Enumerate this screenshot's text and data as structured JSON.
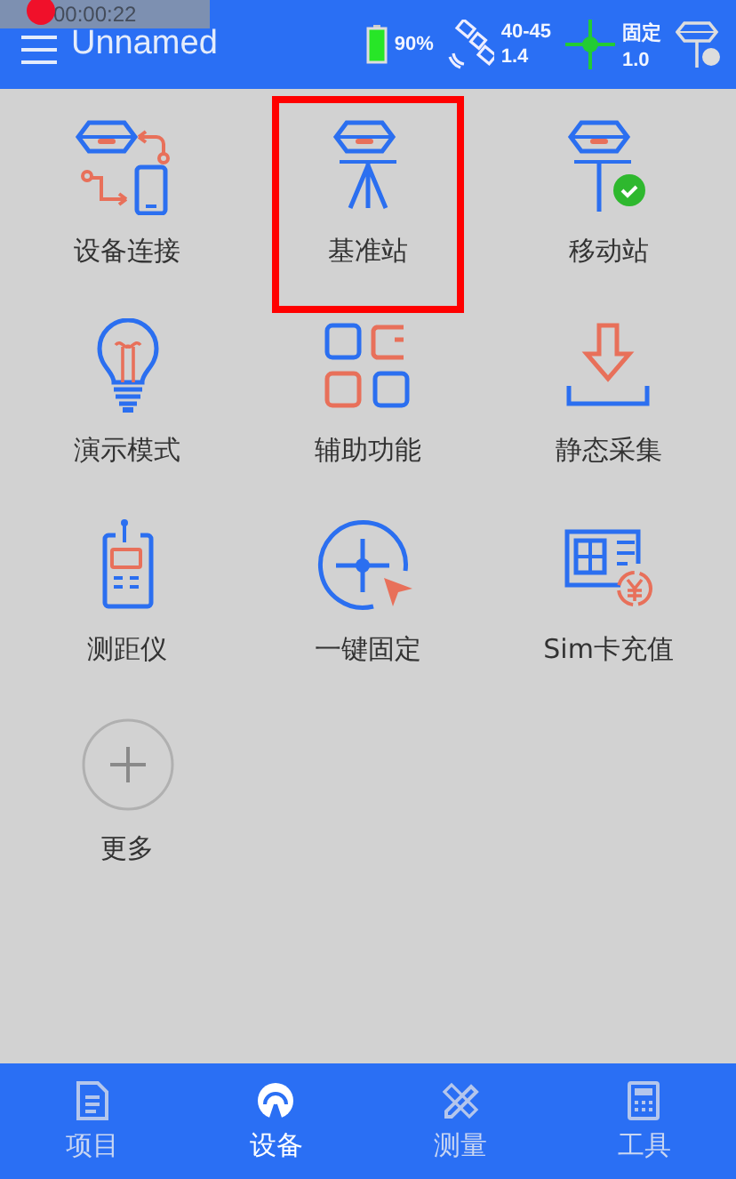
{
  "recording": {
    "time": "00:00:22"
  },
  "header": {
    "title": "Unnamed",
    "battery": "90%",
    "satellites": {
      "count": "40-45",
      "value": "1.4"
    },
    "fix": {
      "status": "固定",
      "value": "1.0"
    }
  },
  "tiles": [
    {
      "label": "设备连接",
      "highlighted": false
    },
    {
      "label": "基准站",
      "highlighted": true
    },
    {
      "label": "移动站",
      "highlighted": false
    },
    {
      "label": "演示模式",
      "highlighted": false
    },
    {
      "label": "辅助功能",
      "highlighted": false
    },
    {
      "label": "静态采集",
      "highlighted": false
    },
    {
      "label": "测距仪",
      "highlighted": false
    },
    {
      "label": "一键固定",
      "highlighted": false
    },
    {
      "label": "Sim卡充值",
      "highlighted": false
    },
    {
      "label": "更多",
      "highlighted": false
    }
  ],
  "tabs": [
    {
      "label": "项目",
      "selected": false
    },
    {
      "label": "设备",
      "selected": true
    },
    {
      "label": "测量",
      "selected": false
    },
    {
      "label": "工具",
      "selected": false
    }
  ]
}
